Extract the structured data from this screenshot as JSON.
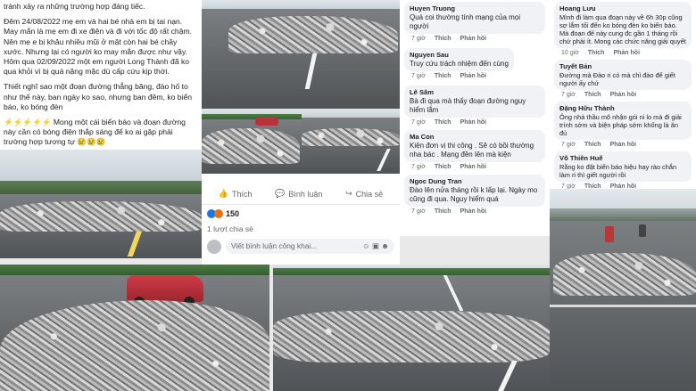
{
  "post": {
    "paragraphs": [
      "tránh xảy ra những trường hợp đáng tiếc.",
      "Đêm 24/08/2022 mẹ em và hai bé nhà em bị tai nạn. May mắn là mẹ em đi xe điện và đi với tốc độ rất chậm. Nên mẹ e bị khâu nhiều mũi ở mặt còn hai bé chầy xước. Nhưng lại có người ko may mắn được như vậy. Hôm qua 02/09/2022 một em người Long Thành đã ko qua khỏi vì bị quá nặng mặc dù cấp cứu kịp thời.",
      "Thiết nghĩ sao một đoạn đường thẳng băng, đào hố to như thế này, ban ngày ko sao, nhưng ban đêm, ko biển báo, ko bóng đèn",
      "⚡⚡⚡⚡⚡ Mong một cái biển báo và đoạn đường này cần có bóng điện thắp sáng để ko ai gặp phải trường hợp tương tự 😢😢😢"
    ]
  },
  "fb": {
    "like_label": "Thích",
    "comment_label": "Bình luận",
    "share_label": "Chia sẻ",
    "reactions_count": "150",
    "shares_text": "1 lượt chia sẻ",
    "comment_placeholder": "Viết bình luận công khai..."
  },
  "comments_mid": [
    {
      "name": "Huyen Truong",
      "text": "Quá coi thường tính mạng của mọi người",
      "time": "7 giờ",
      "like": "Thích",
      "reply": "Phản hồi"
    },
    {
      "name": "Nguyen Sau",
      "text": "Truy cứu trách nhiệm đến cùng",
      "time": "7 giờ",
      "like": "Thích",
      "reply": "Phản hồi"
    },
    {
      "name": "Lê Sâm",
      "text": "Bà đi qua mà thấy đoạn đường nguy hiểm lắm",
      "time": "7 giờ",
      "like": "Thích",
      "reply": "Phản hồi"
    },
    {
      "name": "Ma Con",
      "text": "Kiện đơn vị thi công . Sẽ có bồi thường nha bác . Mạng đền lên mà kiện",
      "time": "7 giờ",
      "like": "Thích",
      "reply": "Phản hồi"
    },
    {
      "name": "Ngoc Dung Tran",
      "text": "Đào lên nửa tháng rồi k lấp lại. Ngày mo cũng đi qua. Nguy hiểm quá",
      "time": "7 giờ",
      "like": "Thích",
      "reply": "Phản hồi"
    }
  ],
  "comments_right": [
    {
      "name": "Hoang Lưu",
      "text": "Mình đi làm qua đoạn này về 6h 30p cũng sợ lắm tối đến ko bóng đèn ko biển báo. Mà đoạn đế này cung đc gần 1 tháng rồi chứ phải ít. Mong các chức năng giải quyết",
      "time": "10 giờ",
      "like": "Thích",
      "reply": "Phản hồi"
    },
    {
      "name": "Tuyết Bản",
      "text": "Đường mà Đào ri có mà chỉ đào để giết người ấy chứ",
      "time": "7 giờ",
      "like": "Thích",
      "reply": "Phản hồi"
    },
    {
      "name": "Đặng Hữu Thành",
      "text": "Ông nhà thầu mô nhận gói ni lo mà đi giải trình sớm và biện pháp sớm khống là ăn đủ",
      "time": "7 giờ",
      "like": "Thích",
      "reply": "Phản hồi"
    },
    {
      "name": "Võ Thiên Huế",
      "text": "Rằng ko đặt biển báo hiệu hay rào chắn làm ri thì giết người rồi",
      "time": "7 giờ",
      "like": "Thích",
      "reply": "Phản hồi"
    }
  ]
}
